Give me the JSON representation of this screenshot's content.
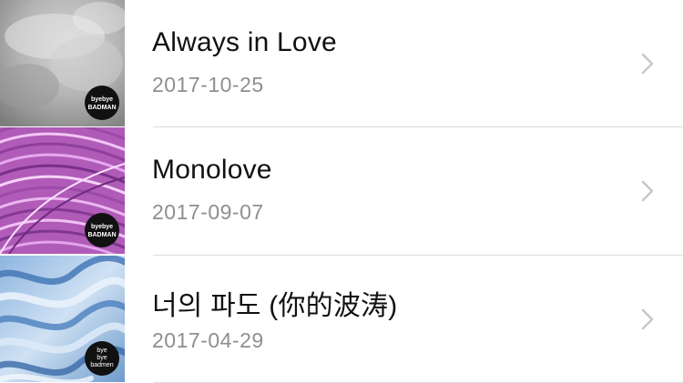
{
  "songs": [
    {
      "title": "Always in Love",
      "date": "2017-10-25",
      "cover_logo_text": "byebye BADMAN",
      "cover_style": "grey-smoke"
    },
    {
      "title": "Monolove",
      "date": "2017-09-07",
      "cover_logo_text": "byebye BADMAN",
      "cover_style": "pink-purple-threads"
    },
    {
      "title": "너의 파도 (你的波涛)",
      "date": "2017-04-29",
      "cover_logo_text": "bye bye badmen",
      "cover_style": "blue-waves"
    }
  ],
  "icons": {
    "disclosure": "chevron-right-icon"
  },
  "colors": {
    "title": "#111111",
    "date": "#8e8e93",
    "separator": "#dcdcdc",
    "chevron": "#c7c7cc"
  }
}
